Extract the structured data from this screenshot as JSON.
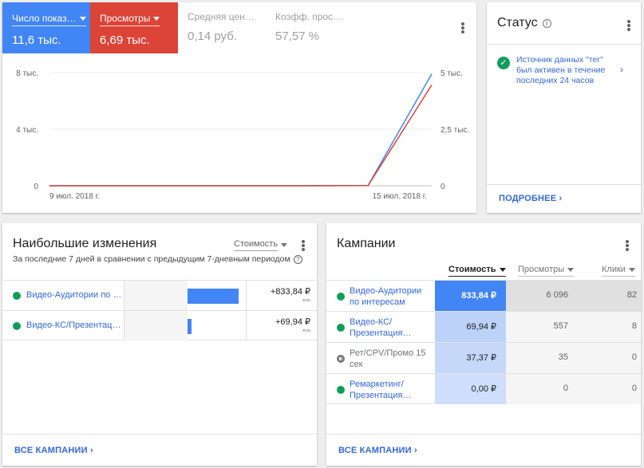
{
  "chart_card": {
    "metrics": [
      {
        "label": "Число показ…",
        "value": "11,6 тыс."
      },
      {
        "label": "Просмотры",
        "value": "6,69 тыс."
      },
      {
        "label": "Средняя цен…",
        "value": "0,14 руб."
      },
      {
        "label": "Коэфф. прос…",
        "value": "57,57 %"
      }
    ],
    "chart_data": {
      "type": "line",
      "x": [
        "9 июл. 2018 г.",
        "10 июл. 2018 г.",
        "11 июл. 2018 г.",
        "12 июл. 2018 г.",
        "13 июл. 2018 г.",
        "14 июл. 2018 г.",
        "15 июл. 2018 г."
      ],
      "x_tick_labels": [
        "9 июл. 2018 г.",
        "15 июл. 2018 г."
      ],
      "series": [
        {
          "name": "Число показ…",
          "axis": "left",
          "color": "#4285f4",
          "values": [
            0,
            0,
            0,
            0,
            0,
            20,
            7900
          ]
        },
        {
          "name": "Просмотры",
          "axis": "right",
          "color": "#db4437",
          "values": [
            0,
            0,
            0,
            0,
            0,
            10,
            4450
          ]
        }
      ],
      "left_axis": {
        "ticks": [
          "0",
          "4 тыс.",
          "8 тыс."
        ],
        "ylim": [
          0,
          8000
        ]
      },
      "right_axis": {
        "ticks": [
          "0",
          "2,5 тыс.",
          "5 тыс."
        ],
        "ylim": [
          0,
          5000
        ]
      },
      "grid": true
    }
  },
  "status_card": {
    "title": "Статус",
    "message": "Источник данных \"тег\" был активен в течение последних 24 часов",
    "link": "ПОДРОБНЕЕ"
  },
  "changes_card": {
    "title": "Наибольшие изменения",
    "subtitle": "За последние 7 дней в сравнении с предыдущим 7-дневным периодом",
    "selector": "Стоимость",
    "rows": [
      {
        "name": "Видео-Аудитории по …",
        "value": "+833,84 ₽",
        "delta": "+∞",
        "bar_fraction": 1.0
      },
      {
        "name": "Видео-КС/Презентац…",
        "value": "+69,94 ₽",
        "delta": "+∞",
        "bar_fraction": 0.084
      }
    ],
    "link": "ВСЕ КАМПАНИИ"
  },
  "campaigns_card": {
    "title": "Кампании",
    "headers": {
      "cost": "Стоимость",
      "views": "Просмотры",
      "clicks": "Клики"
    },
    "rows": [
      {
        "name": "Видео-Аудитории по интересам",
        "status": "active",
        "cost": "833,84 ₽",
        "views": "6 096",
        "clicks": "82"
      },
      {
        "name": "Видео-КС/ Презентация…",
        "status": "active",
        "cost": "69,94 ₽",
        "views": "557",
        "clicks": "8"
      },
      {
        "name": "Рет/CPV/Промо 15 сек",
        "status": "paused",
        "cost": "37,37 ₽",
        "views": "35",
        "clicks": "0"
      },
      {
        "name": "Ремаркетинг/ Презентация…",
        "status": "active",
        "cost": "0,00 ₽",
        "views": "0",
        "clicks": "0"
      }
    ],
    "link": "ВСЕ КАМПАНИИ"
  },
  "colors": {
    "accent_blue": "#4285f4",
    "accent_red": "#db4437",
    "link_blue": "#3367d6",
    "status_green": "#0f9d58"
  }
}
